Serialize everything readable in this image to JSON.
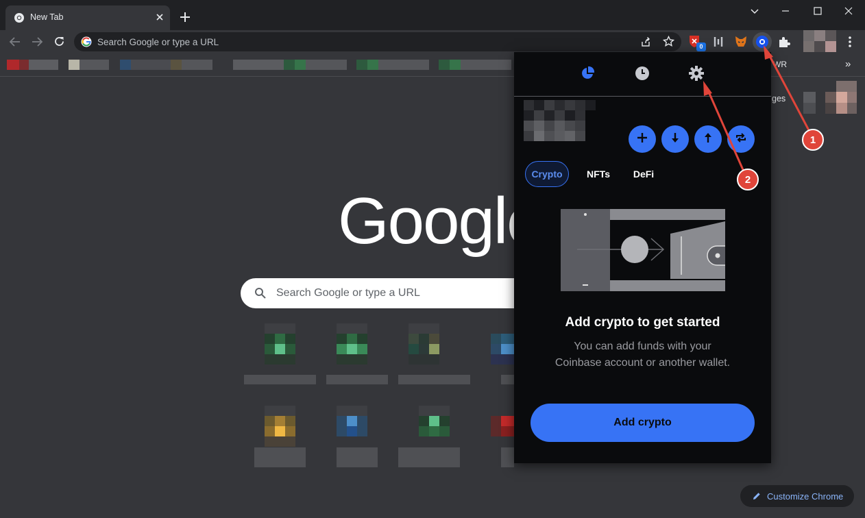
{
  "tab": {
    "title": "New Tab"
  },
  "omnibox": {
    "placeholder": "Search Google or type a URL"
  },
  "bookmarks": {
    "partial_label": "WR",
    "more": "»"
  },
  "ntp": {
    "logo": "Google",
    "search_placeholder": "Search Google or type a URL",
    "partial_label": "ges",
    "customize_label": "Customize Chrome"
  },
  "extensions": {
    "badge_count": "0"
  },
  "popup": {
    "tabs": [
      "Crypto",
      "NFTs",
      "DeFi"
    ],
    "heading": "Add crypto to get started",
    "description_line1": "You can add funds with your",
    "description_line2": "Coinbase account or another wallet.",
    "add_button": "Add crypto"
  },
  "annotations": {
    "marker1": "1",
    "marker2": "2"
  },
  "colors": {
    "accent": "#3773f5",
    "annotation": "#e0453a",
    "popup_bg": "#0a0b0d"
  }
}
